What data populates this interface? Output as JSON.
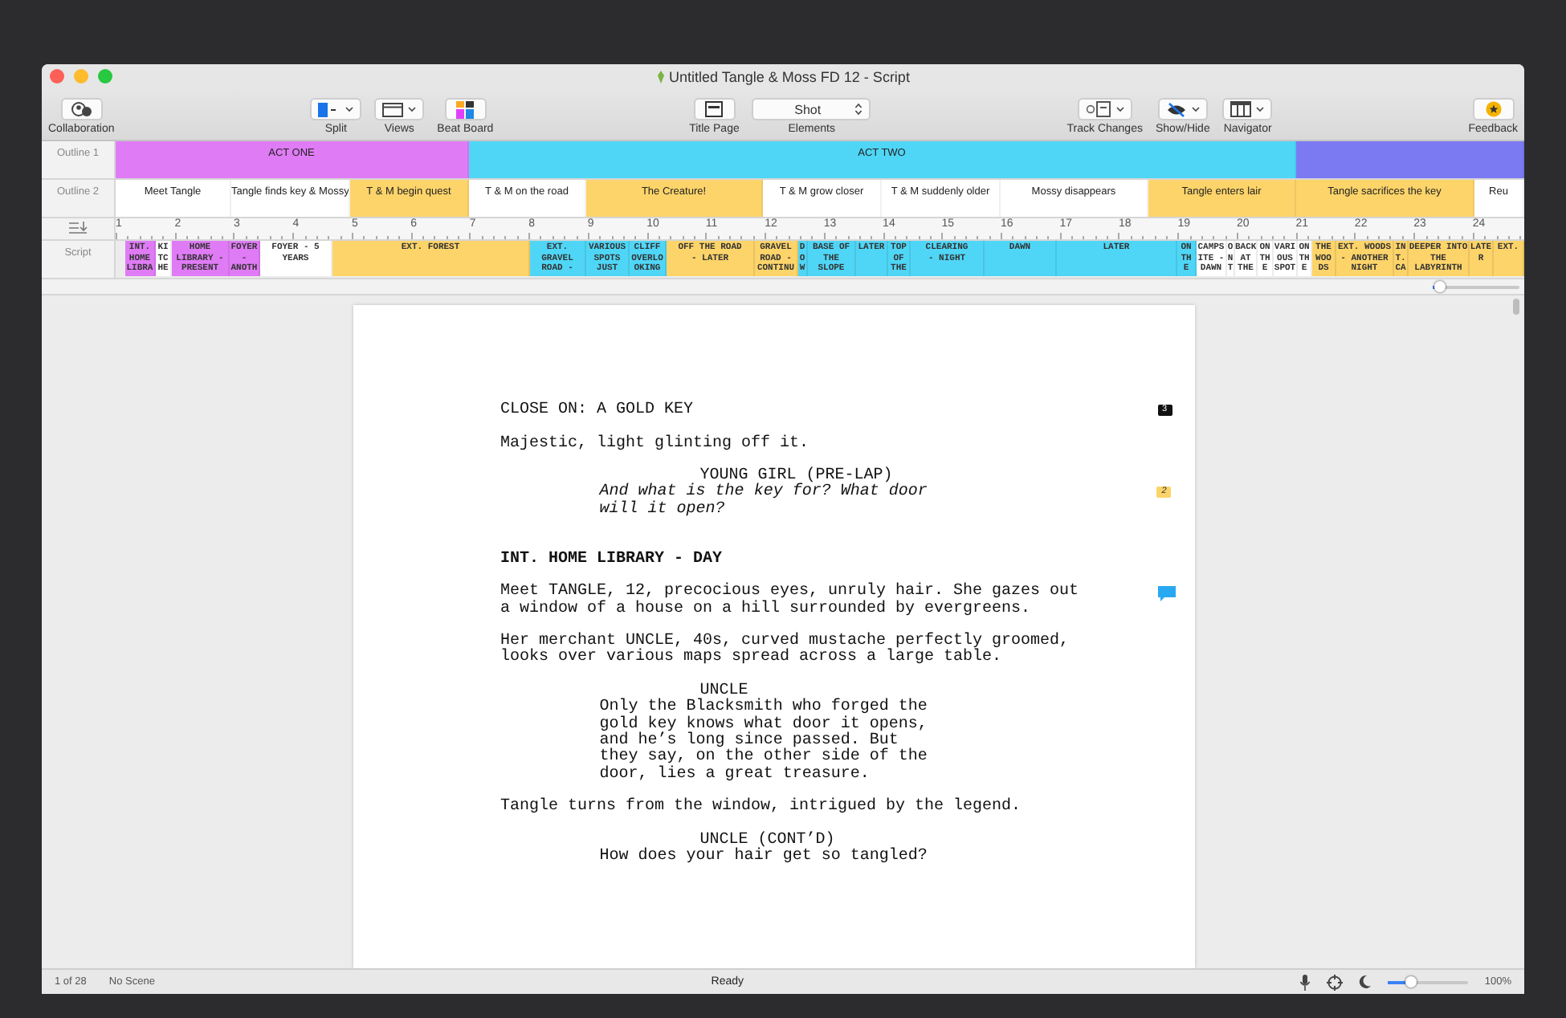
{
  "window": {
    "title": "Untitled Tangle & Moss FD 12 - Script"
  },
  "toolbar": {
    "items": [
      {
        "kind": "collab",
        "label": "Collaboration"
      },
      {
        "kind": "split",
        "label": "Split"
      },
      {
        "kind": "views",
        "label": "Views"
      },
      {
        "kind": "beatboard",
        "label": "Beat Board"
      },
      {
        "kind": "titlepage",
        "label": "Title Page"
      },
      {
        "kind": "elements",
        "label": "Elements",
        "value": "Shot"
      },
      {
        "kind": "track",
        "label": "Track Changes"
      },
      {
        "kind": "showhide",
        "label": "Show/Hide"
      },
      {
        "kind": "navigator",
        "label": "Navigator"
      },
      {
        "kind": "feedback",
        "label": "Feedback"
      }
    ]
  },
  "outline_1": {
    "label": "Outline 1",
    "items": [
      {
        "title": "ACT ONE",
        "color": "#e07bf6"
      },
      {
        "title": "ACT TWO",
        "color": "#4fd6f6"
      },
      {
        "color": "#7c7af2"
      }
    ]
  },
  "outline_2": {
    "label": "Outline 2",
    "items": [
      {
        "title": "Meet Tangle",
        "color": "#ffffff"
      },
      {
        "title": "Tangle finds key & Mossy",
        "color": "#ffffff"
      },
      {
        "title": "T & M begin quest",
        "color": "#fdd46a"
      },
      {
        "title": "T & M on the road",
        "color": "#ffffff"
      },
      {
        "title": "The Creature!",
        "color": "#fdd46a"
      },
      {
        "title": "T & M grow closer",
        "color": "#ffffff"
      },
      {
        "title": "T & M suddenly older",
        "color": "#ffffff"
      },
      {
        "title": "Mossy disappears",
        "color": "#ffffff"
      },
      {
        "title": "Tangle enters lair",
        "color": "#fdd46a"
      },
      {
        "title": "Tangle sacrifices the key",
        "color": "#fdd46a"
      },
      {
        "title": "Reu",
        "color": "#ffffff"
      }
    ]
  },
  "ruler": {
    "numbers": [
      "1",
      "2",
      "3",
      "4",
      "5",
      "6",
      "7",
      "8",
      "9",
      "10",
      "11",
      "12",
      "13",
      "14",
      "15",
      "16",
      "17",
      "18",
      "19",
      "20",
      "21",
      "22",
      "23",
      "24"
    ]
  },
  "script_track": {
    "label": "Script",
    "scenes": [
      {
        "title": "INT.\nHOME\nLIBRA",
        "color": "#e07bf6"
      },
      {
        "title": "KI\nTC\nHE",
        "color": "#ffffff"
      },
      {
        "title": "HOME\nLIBRARY -\nPRESENT",
        "color": "#e07bf6"
      },
      {
        "title": "FOYER\n-\nANOTH",
        "color": "#e07bf6"
      },
      {
        "title": "FOYER - 5\nYEARS",
        "color": "#ffffff"
      },
      {
        "title": "EXT. FOREST",
        "color": "#fdd46a"
      },
      {
        "title": "EXT.\nGRAVEL\nROAD -",
        "color": "#4fd6f6"
      },
      {
        "title": "VARIOUS\nSPOTS\nJUST",
        "color": "#4fd6f6"
      },
      {
        "title": "CLIFF\nOVERLO\nOKING",
        "color": "#4fd6f6"
      },
      {
        "title": "OFF THE ROAD\n- LATER",
        "color": "#fdd46a"
      },
      {
        "title": "GRAVEL\nROAD -\nCONTINU",
        "color": "#fdd46a"
      },
      {
        "title": "D\nO\nW",
        "color": "#4fd6f6"
      },
      {
        "title": "BASE OF\nTHE\nSLOPE",
        "color": "#4fd6f6"
      },
      {
        "title": "LATER",
        "color": "#4fd6f6"
      },
      {
        "title": "TOP\nOF\nTHE",
        "color": "#4fd6f6"
      },
      {
        "title": "CLEARING\n- NIGHT",
        "color": "#4fd6f6"
      },
      {
        "title": "DAWN",
        "color": "#4fd6f6"
      },
      {
        "title": "LATER",
        "color": "#4fd6f6"
      },
      {
        "title": "ON\nTH\nE",
        "color": "#4fd6f6"
      },
      {
        "title": "CAMPS\nITE -\nDAWN",
        "color": "#ffffff"
      },
      {
        "title": "O\nN\nT",
        "color": "#ffffff"
      },
      {
        "title": "BACK\nAT\nTHE",
        "color": "#ffffff"
      },
      {
        "title": "ON\nTH\nE",
        "color": "#ffffff"
      },
      {
        "title": "VARI\nOUS\nSPOT",
        "color": "#ffffff"
      },
      {
        "title": "ON\nTH\nE",
        "color": "#ffffff"
      },
      {
        "title": "THE\nWOO\nDS",
        "color": "#fdd46a"
      },
      {
        "title": "EXT. WOODS\n- ANOTHER\nNIGHT",
        "color": "#fdd46a"
      },
      {
        "title": "IN\nT.\nCA",
        "color": "#fdd46a"
      },
      {
        "title": "DEEPER INTO\nTHE\nLABYRINTH",
        "color": "#fdd46a"
      },
      {
        "title": "LATE\nR",
        "color": "#fdd46a"
      },
      {
        "title": "EXT.",
        "color": "#fdd46a"
      }
    ],
    "zoom": {
      "level": 0.08
    }
  },
  "script": {
    "elements": [
      {
        "kind": "action",
        "text": "CLOSE ON: A GOLD KEY",
        "marker": {
          "kind": "dark",
          "text": "3"
        }
      },
      {
        "kind": "action",
        "text": "Majestic, light glinting off it."
      },
      {
        "kind": "character",
        "text": "YOUNG GIRL (PRE-LAP)"
      },
      {
        "kind": "dialogue",
        "italic": true,
        "text": "And what is the key for? What door will it open?",
        "marker": {
          "kind": "yellow",
          "text": "2"
        }
      },
      {
        "kind": "heading",
        "text": "INT. HOME LIBRARY - DAY"
      },
      {
        "kind": "action",
        "text": "Meet TANGLE, 12, precocious eyes, unruly hair. She gazes out a window of a house on a hill surrounded by evergreens.",
        "marker": {
          "kind": "bubble"
        }
      },
      {
        "kind": "action",
        "text": "Her merchant UNCLE, 40s, curved mustache perfectly groomed, looks over various maps spread across a large table."
      },
      {
        "kind": "character",
        "text": "UNCLE"
      },
      {
        "kind": "dialogue",
        "italic": false,
        "text": "Only the Blacksmith who forged the gold key knows what door it opens, and he’s long since passed. But they say, on the other side of the door, lies a great treasure."
      },
      {
        "kind": "action",
        "text": "Tangle turns from the window, intrigued by the legend."
      },
      {
        "kind": "character",
        "text": "UNCLE (CONT’D)"
      },
      {
        "kind": "dialogue",
        "italic": false,
        "text": "How does your hair get so tangled?"
      }
    ]
  },
  "status_bar": {
    "page": "1 of 28",
    "scene": "No Scene",
    "status": "Ready",
    "zoom": {
      "level": 0.28,
      "reading": "100%"
    }
  }
}
